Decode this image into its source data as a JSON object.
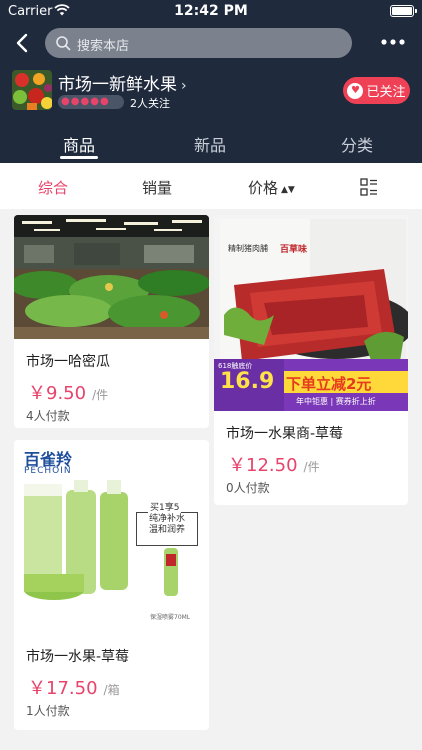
{
  "status_bar": {
    "carrier": "Carrier",
    "time": "12:42 PM"
  },
  "search": {
    "placeholder": "搜索本店"
  },
  "shop": {
    "name": "市场一新鲜水果",
    "rating_stars": 5,
    "followers": "2人关注",
    "follow_label": "已关注"
  },
  "tabs": [
    {
      "label": "商品",
      "active": true
    },
    {
      "label": "新品",
      "active": false
    },
    {
      "label": "分类",
      "active": false
    }
  ],
  "sort": {
    "overall": "综合",
    "sales": "销量",
    "price": "价格"
  },
  "products": [
    {
      "title": "市场一哈密瓜",
      "price": "￥9.50",
      "unit": "/件",
      "sold": "4人付款",
      "image": "supermarket-photo"
    },
    {
      "title": "市场一水果商-草莓",
      "price": "￥12.50",
      "unit": "/件",
      "sold": "0人付款",
      "image": "beef-jerky-photo",
      "banner": {
        "tag": "618触底价",
        "price": "16.9",
        "slogan": "下单立减2元",
        "sub": "年中钜惠 | 赛券折上折"
      },
      "package": {
        "brand": "百草味",
        "name": "精制猪肉脯"
      }
    },
    {
      "title": "市场一水果-草莓",
      "price": "￥17.50",
      "unit": "/箱",
      "sold": "1人付款",
      "image": "skincare-photo",
      "brand": {
        "cn": "百雀羚",
        "en": "PECHOIN"
      },
      "promo": {
        "buy": "买1享5",
        "line1": "纯净补水",
        "line2": "温和润养",
        "note": "保湿喷雾70ML"
      }
    }
  ],
  "colors": {
    "header_bg": "#1f2a3d",
    "accent": "#e8436b",
    "follow_bg": "#ef4156"
  },
  "icons": [
    "back-chevron-icon",
    "search-icon",
    "more-dots-icon",
    "heart-icon",
    "sort-arrows-icon",
    "grid-toggle-icon",
    "wifi-icon",
    "battery-icon"
  ]
}
